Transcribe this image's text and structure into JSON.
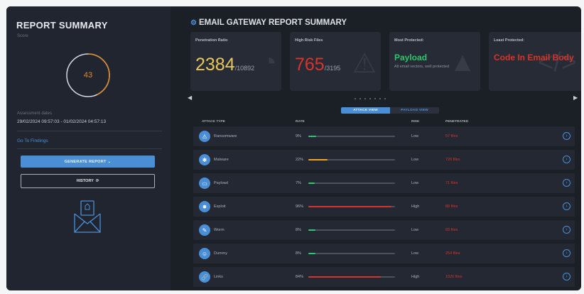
{
  "left": {
    "title": "REPORT SUMMARY",
    "subtitle": "Score",
    "score": "43",
    "score_fraction": 0.43,
    "assessment_label": "Assessment dates",
    "assessment_dates": "29/02/2024 09:57:03 - 01/02/2024 04:57:13",
    "go_to_findings": "Go To Findings",
    "generate_report": "GENERATE REPORT  ⌄",
    "history": "HISTORY"
  },
  "main": {
    "title": "EMAIL GATEWAY REPORT SUMMARY",
    "cards": [
      {
        "label": "Penetration Ratio",
        "big": "2384",
        "small": "/10892",
        "color": "#e8c75a"
      },
      {
        "label": "High Risk Files",
        "big": "765",
        "small": "/3195",
        "color": "#d9342b"
      },
      {
        "label": "Most Protected:",
        "word": "Payload",
        "note": "All email vectors, well protected",
        "color": "#2cc86b"
      },
      {
        "label": "Least Protected:",
        "word": "Code In Email Body",
        "color": "#d9342b"
      }
    ],
    "toggle": {
      "attack_view": "ATTACK VIEW",
      "payload_view": "PAYLOAD VIEW"
    },
    "headers": {
      "attack_type": "ATTACK TYPE",
      "rate": "RATE",
      "risk": "RISK",
      "penetrated": "PENETRATED"
    },
    "rows": [
      {
        "name": "Ransomware",
        "rate": "9%",
        "fill": 0.09,
        "fill_color": "#2cc86b",
        "risk": "Low",
        "penetrated": "57 files",
        "icon": "ransomware-icon"
      },
      {
        "name": "Malware",
        "rate": "22%",
        "fill": 0.22,
        "fill_color": "#e8a530",
        "risk": "Low",
        "penetrated": "726 files",
        "icon": "malware-icon"
      },
      {
        "name": "Payload",
        "rate": "7%",
        "fill": 0.07,
        "fill_color": "#2cc86b",
        "risk": "Low",
        "penetrated": "71 files",
        "icon": "payload-icon"
      },
      {
        "name": "Exploit",
        "rate": "96%",
        "fill": 0.96,
        "fill_color": "#d9342b",
        "risk": "High",
        "penetrated": "88 files",
        "icon": "exploit-icon"
      },
      {
        "name": "Worm",
        "rate": "8%",
        "fill": 0.08,
        "fill_color": "#2cc86b",
        "risk": "Low",
        "penetrated": "83 files",
        "icon": "worm-icon"
      },
      {
        "name": "Dummy",
        "rate": "8%",
        "fill": 0.08,
        "fill_color": "#2cc86b",
        "risk": "Low",
        "penetrated": "254 files",
        "icon": "dummy-icon"
      },
      {
        "name": "Links",
        "rate": "84%",
        "fill": 0.84,
        "fill_color": "#d9342b",
        "risk": "High",
        "penetrated": "1026 files",
        "icon": "links-icon"
      }
    ]
  }
}
